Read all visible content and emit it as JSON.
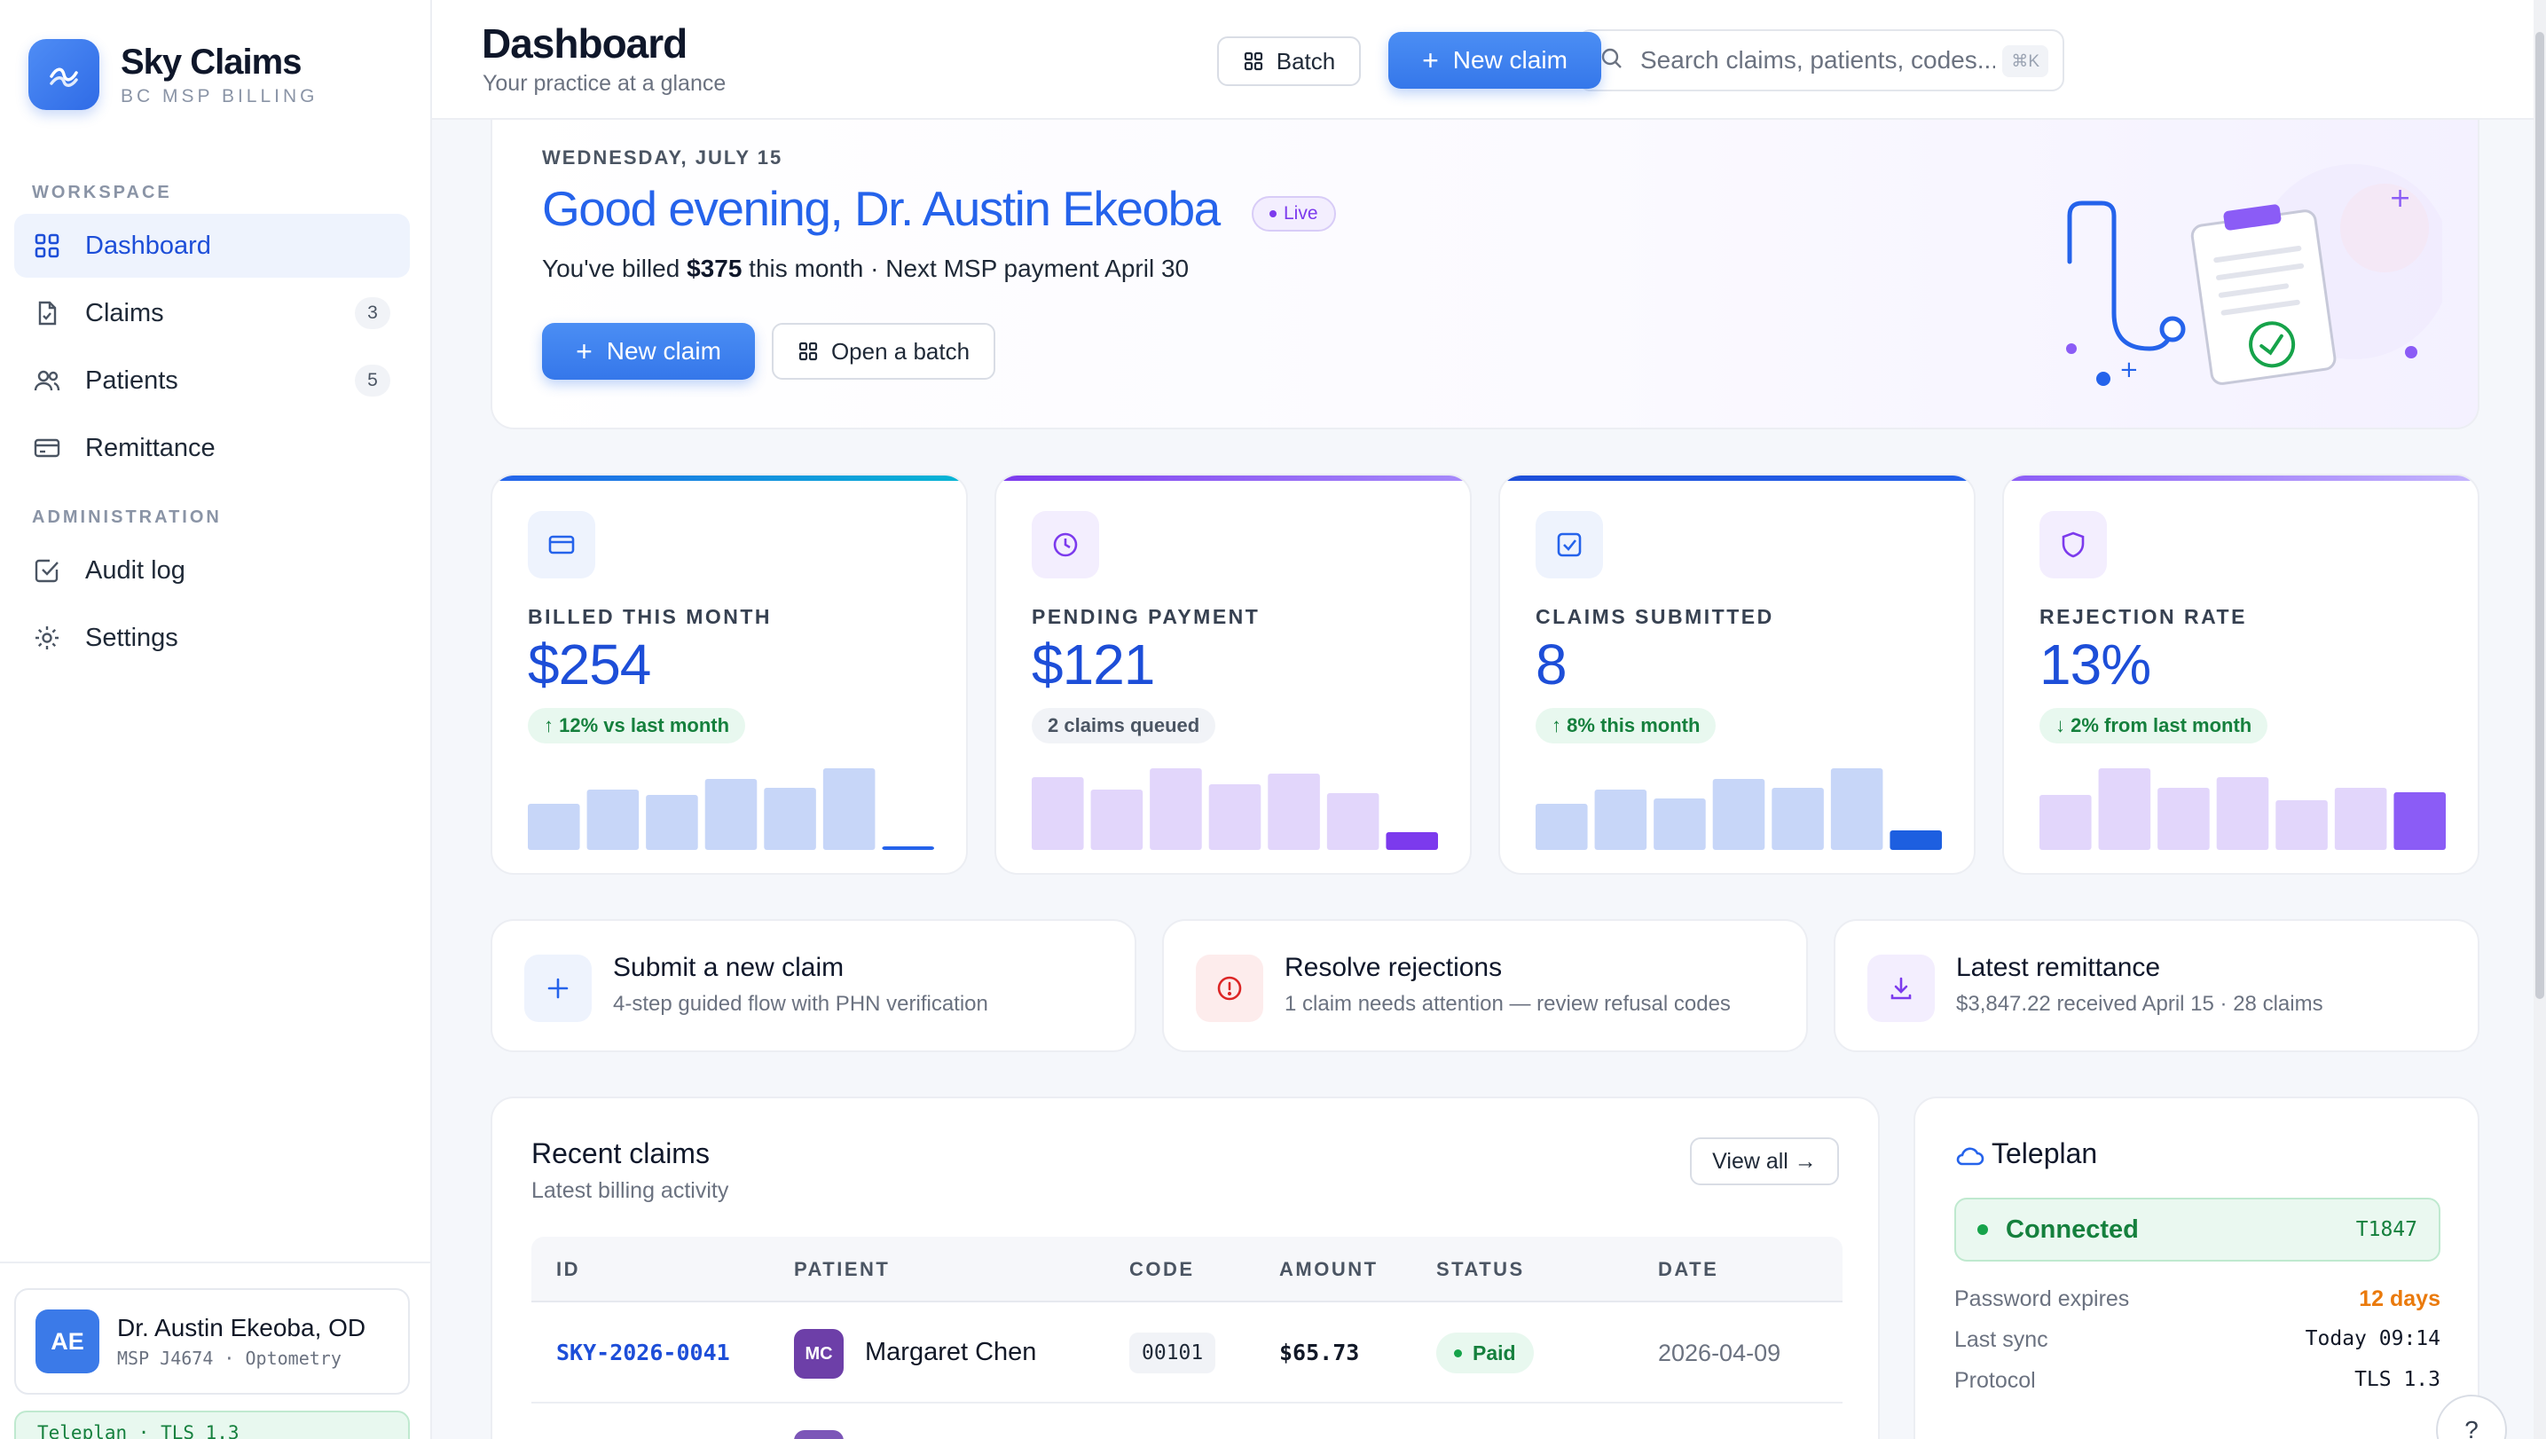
{
  "brand": {
    "name": "Sky Claims",
    "subtitle": "BC MSP BILLING"
  },
  "sidebar": {
    "sections": {
      "workspace": "WORKSPACE",
      "administration": "ADMINISTRATION"
    },
    "items": [
      {
        "label": "Dashboard",
        "icon": "grid-icon",
        "active": true
      },
      {
        "label": "Claims",
        "icon": "document-icon",
        "badge": "3"
      },
      {
        "label": "Patients",
        "icon": "users-icon",
        "badge": "5"
      },
      {
        "label": "Remittance",
        "icon": "card-icon"
      },
      {
        "label": "Audit log",
        "icon": "checkbox-icon"
      },
      {
        "label": "Settings",
        "icon": "gear-icon"
      }
    ],
    "user": {
      "initials": "AE",
      "name": "Dr. Austin Ekeoba, OD",
      "meta": "MSP J4674 · Optometry"
    },
    "teleplan_status": "Teleplan · TLS 1.3"
  },
  "topbar": {
    "title": "Dashboard",
    "subtitle": "Your practice at a glance",
    "search_placeholder": "Search claims, patients, codes...",
    "search_shortcut": "⌘K",
    "batch_label": "Batch",
    "new_claim_label": "New claim"
  },
  "hero": {
    "date": "WEDNESDAY, JULY 15",
    "greeting": "Good evening, Dr. Austin Ekeoba",
    "live_label": "Live",
    "billed_prefix": "You've billed ",
    "billed_amount": "$375",
    "billed_suffix": " this month · Next MSP payment April 30",
    "new_claim_label": "New claim",
    "open_batch_label": "Open a batch"
  },
  "stats": [
    {
      "label": "BILLED THIS MONTH",
      "value": "$254",
      "chip": "↑ 12% vs last month",
      "accent": "#2563eb",
      "bars": [
        0.52,
        0.68,
        0.62,
        0.8,
        0.7,
        0.92,
        0.04
      ],
      "bar_color": "#c7d6f8",
      "last_color": "#2563eb"
    },
    {
      "label": "PENDING PAYMENT",
      "value": "$121",
      "chip": "2 claims queued",
      "accent": "#7c3aed",
      "bars": [
        0.82,
        0.68,
        0.92,
        0.74,
        0.86,
        0.64,
        0.2
      ],
      "bar_color": "#e2d6fb",
      "last_color": "#7c3aed"
    },
    {
      "label": "CLAIMS SUBMITTED",
      "value": "8",
      "chip": "↑ 8% this month",
      "accent": "#2563eb",
      "bars": [
        0.52,
        0.68,
        0.58,
        0.8,
        0.7,
        0.92,
        0.22
      ],
      "bar_color": "#c7d6f8",
      "last_color": "#1d5fe0"
    },
    {
      "label": "REJECTION RATE",
      "value": "13%",
      "chip": "↓ 2% from last month",
      "accent": "#7c3aed",
      "bars": [
        0.62,
        0.92,
        0.7,
        0.82,
        0.56,
        0.7,
        0.65
      ],
      "bar_color": "#e2d6fb",
      "last_color": "#8b5cf6"
    }
  ],
  "actions": [
    {
      "title": "Submit a new claim",
      "subtitle": "4-step guided flow with PHN verification"
    },
    {
      "title": "Resolve rejections",
      "subtitle": "1 claim needs attention — review refusal codes"
    },
    {
      "title": "Latest remittance",
      "subtitle": "$3,847.22 received April 15 · 28 claims"
    }
  ],
  "recent": {
    "title": "Recent claims",
    "subtitle": "Latest billing activity",
    "view_all": "View all →",
    "columns": [
      "ID",
      "PATIENT",
      "CODE",
      "AMOUNT",
      "STATUS",
      "DATE"
    ],
    "rows": [
      {
        "id": "SKY-2026-0041",
        "initials": "MC",
        "patient": "Margaret Chen",
        "code": "00101",
        "amount": "$65.73",
        "status": "Paid",
        "date": "2026-04-09"
      }
    ]
  },
  "teleplan": {
    "title": "Teleplan",
    "status": "Connected",
    "id": "T1847",
    "rows": [
      {
        "label": "Password expires",
        "value": "12 days"
      },
      {
        "label": "Last sync",
        "value": "Today 09:14"
      },
      {
        "label": "Protocol",
        "value": "TLS 1.3"
      }
    ]
  },
  "help_label": "?"
}
